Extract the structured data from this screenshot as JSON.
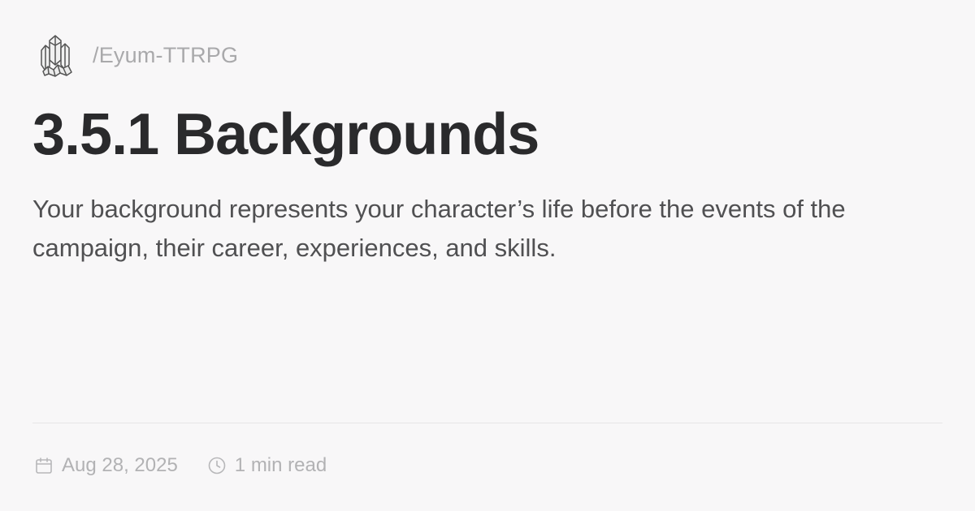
{
  "site": {
    "logo_icon": "crystal-cluster-icon",
    "path": "/Eyum-TTRPG"
  },
  "page": {
    "title": "3.5.1 Backgrounds",
    "description": "Your background represents your character’s life before the events of the campaign, their career, experiences, and skills."
  },
  "meta": {
    "date_icon": "calendar-icon",
    "date": "Aug 28, 2025",
    "read_time_icon": "clock-icon",
    "read_time": "1 min read"
  },
  "colors": {
    "background": "#f8f7f8",
    "title": "#2a2a2c",
    "description": "#505052",
    "muted": "#a9a9ab",
    "divider": "#e6e5e7"
  }
}
